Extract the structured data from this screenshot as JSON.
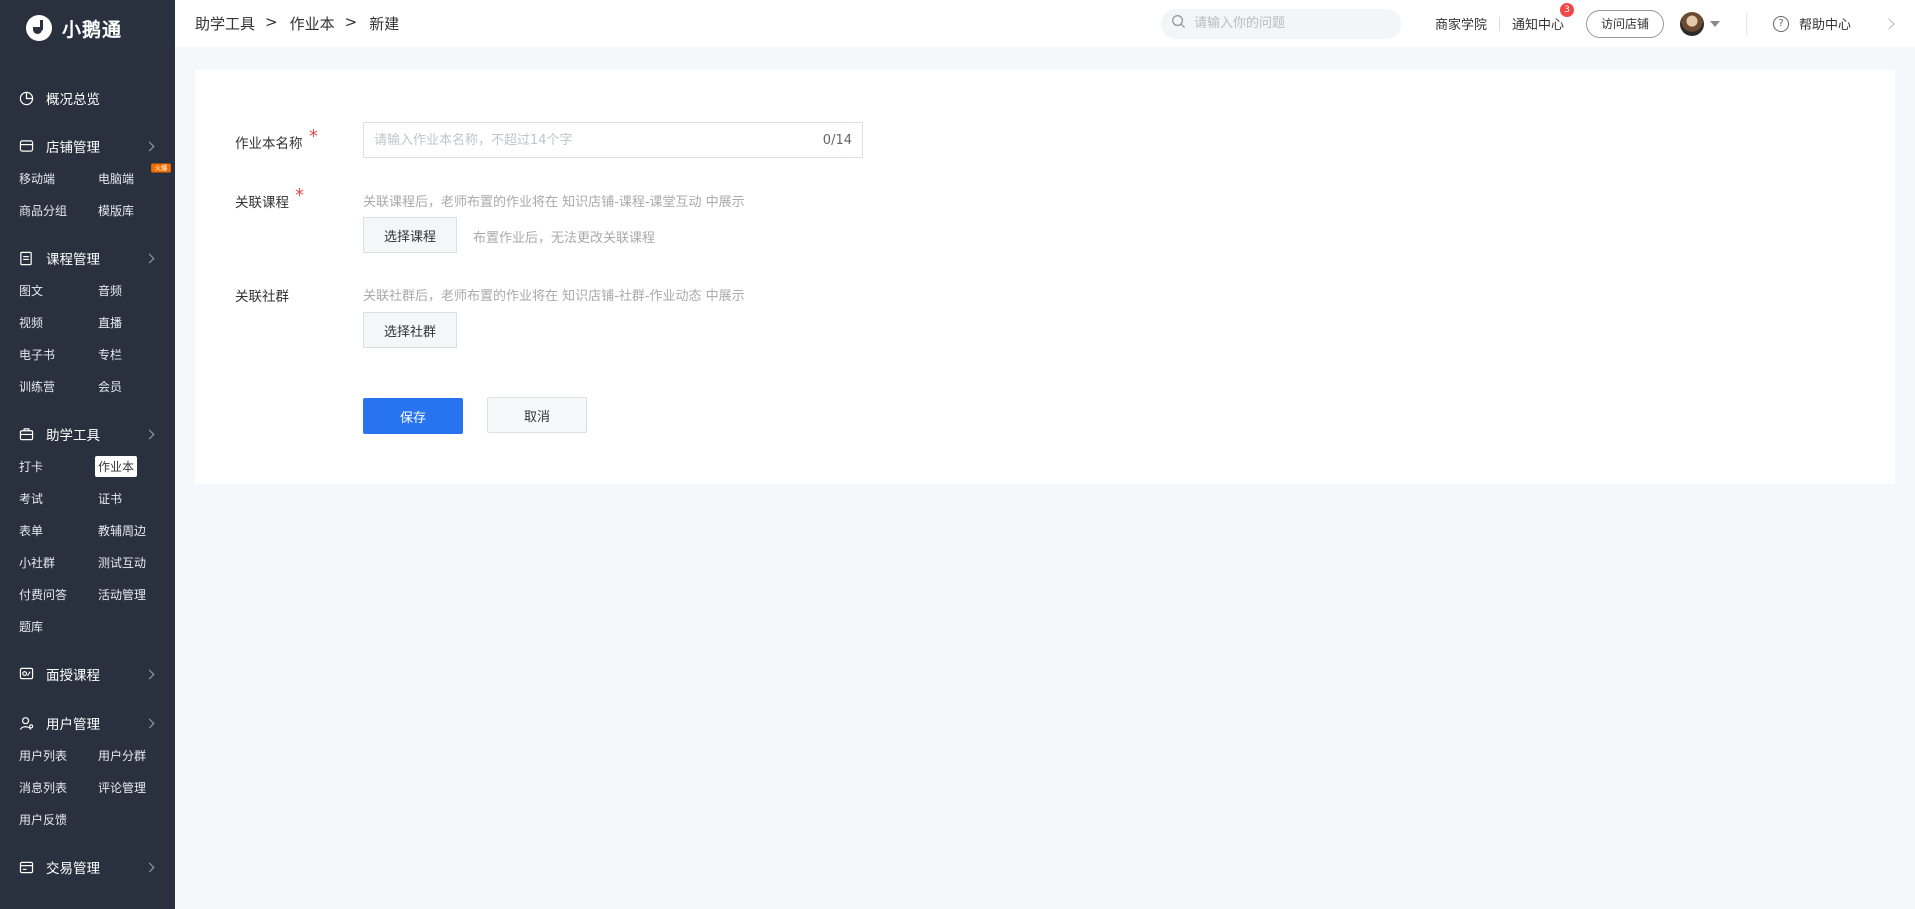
{
  "brand": {
    "name": "小鹅通"
  },
  "sidebar": {
    "overview": "概况总览",
    "groups": [
      {
        "label": "店铺管理",
        "icon": "store-icon",
        "items": [
          "移动端",
          "电脑端",
          "商品分组",
          "模版库"
        ],
        "hot_badge": "火爆"
      },
      {
        "label": "课程管理",
        "icon": "book-icon",
        "items": [
          "图文",
          "音频",
          "视频",
          "直播",
          "电子书",
          "专栏",
          "训练营",
          "会员"
        ]
      },
      {
        "label": "助学工具",
        "icon": "briefcase-icon",
        "items": [
          "打卡",
          "作业本",
          "考试",
          "证书",
          "表单",
          "教辅周边",
          "小社群",
          "测试互动",
          "付费问答",
          "活动管理",
          "题库"
        ],
        "active": "作业本"
      },
      {
        "label": "面授课程",
        "icon": "classroom-icon",
        "items": []
      },
      {
        "label": "用户管理",
        "icon": "user-icon",
        "items": [
          "用户列表",
          "用户分群",
          "消息列表",
          "评论管理",
          "用户反馈"
        ]
      },
      {
        "label": "交易管理",
        "icon": "trade-icon",
        "items": []
      }
    ]
  },
  "topbar": {
    "breadcrumb": [
      "助学工具",
      "作业本",
      "新建"
    ],
    "breadcrumb_sep": ">",
    "search_placeholder": "请输入你的问题",
    "merchant_academy": "商家学院",
    "notifications": "通知中心",
    "notification_count": "3",
    "visit_store": "访问店铺",
    "help_center": "帮助中心"
  },
  "form": {
    "name_label": "作业本名称",
    "name_placeholder": "请输入作业本名称，不超过14个字",
    "name_value": "",
    "name_counter": "0/14",
    "course_label": "关联课程",
    "course_hint": "关联课程后，老师布置的作业将在 知识店铺-课程-课堂互动 中展示",
    "course_button": "选择课程",
    "course_inline_hint": "布置作业后，无法更改关联课程",
    "community_label": "关联社群",
    "community_hint": "关联社群后，老师布置的作业将在 知识店铺-社群-作业动态 中展示",
    "community_button": "选择社群",
    "save": "保存",
    "cancel": "取消",
    "required_mark": "*"
  },
  "colors": {
    "sidebar_bg": "#29313f",
    "primary": "#2874f0",
    "badge": "#f04848",
    "hot": "#f56c00"
  }
}
